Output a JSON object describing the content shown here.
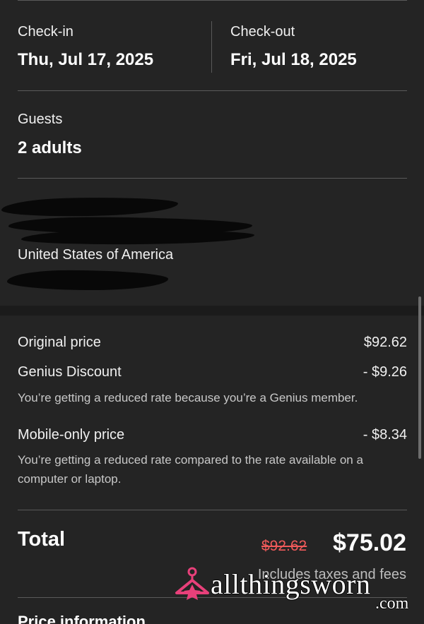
{
  "checkin": {
    "label": "Check-in",
    "date": "Thu, Jul 17, 2025"
  },
  "checkout": {
    "label": "Check-out",
    "date": "Fri, Jul 18, 2025"
  },
  "guests": {
    "label": "Guests",
    "value": "2 adults"
  },
  "address": {
    "country": "United States of America"
  },
  "pricing": {
    "original": {
      "label": "Original price",
      "amount": "$92.62"
    },
    "genius": {
      "label": "Genius Discount",
      "amount": "- $9.26",
      "note": "You’re getting a reduced rate because you’re a Genius member."
    },
    "mobile": {
      "label": "Mobile-only price",
      "amount": "- $8.34",
      "note": "You’re getting a reduced rate compared to the rate available on a computer or laptop."
    }
  },
  "total": {
    "label": "Total",
    "original": "$92.62",
    "amount": "$75.02",
    "taxes_note": "Includes taxes and fees"
  },
  "price_info": {
    "label": "Price information"
  },
  "watermark": {
    "text": "allthingsworn",
    "suffix": ".com"
  },
  "colors": {
    "background": "#242424",
    "strike_red": "#f05a5a",
    "brand_pink": "#e8407a"
  }
}
